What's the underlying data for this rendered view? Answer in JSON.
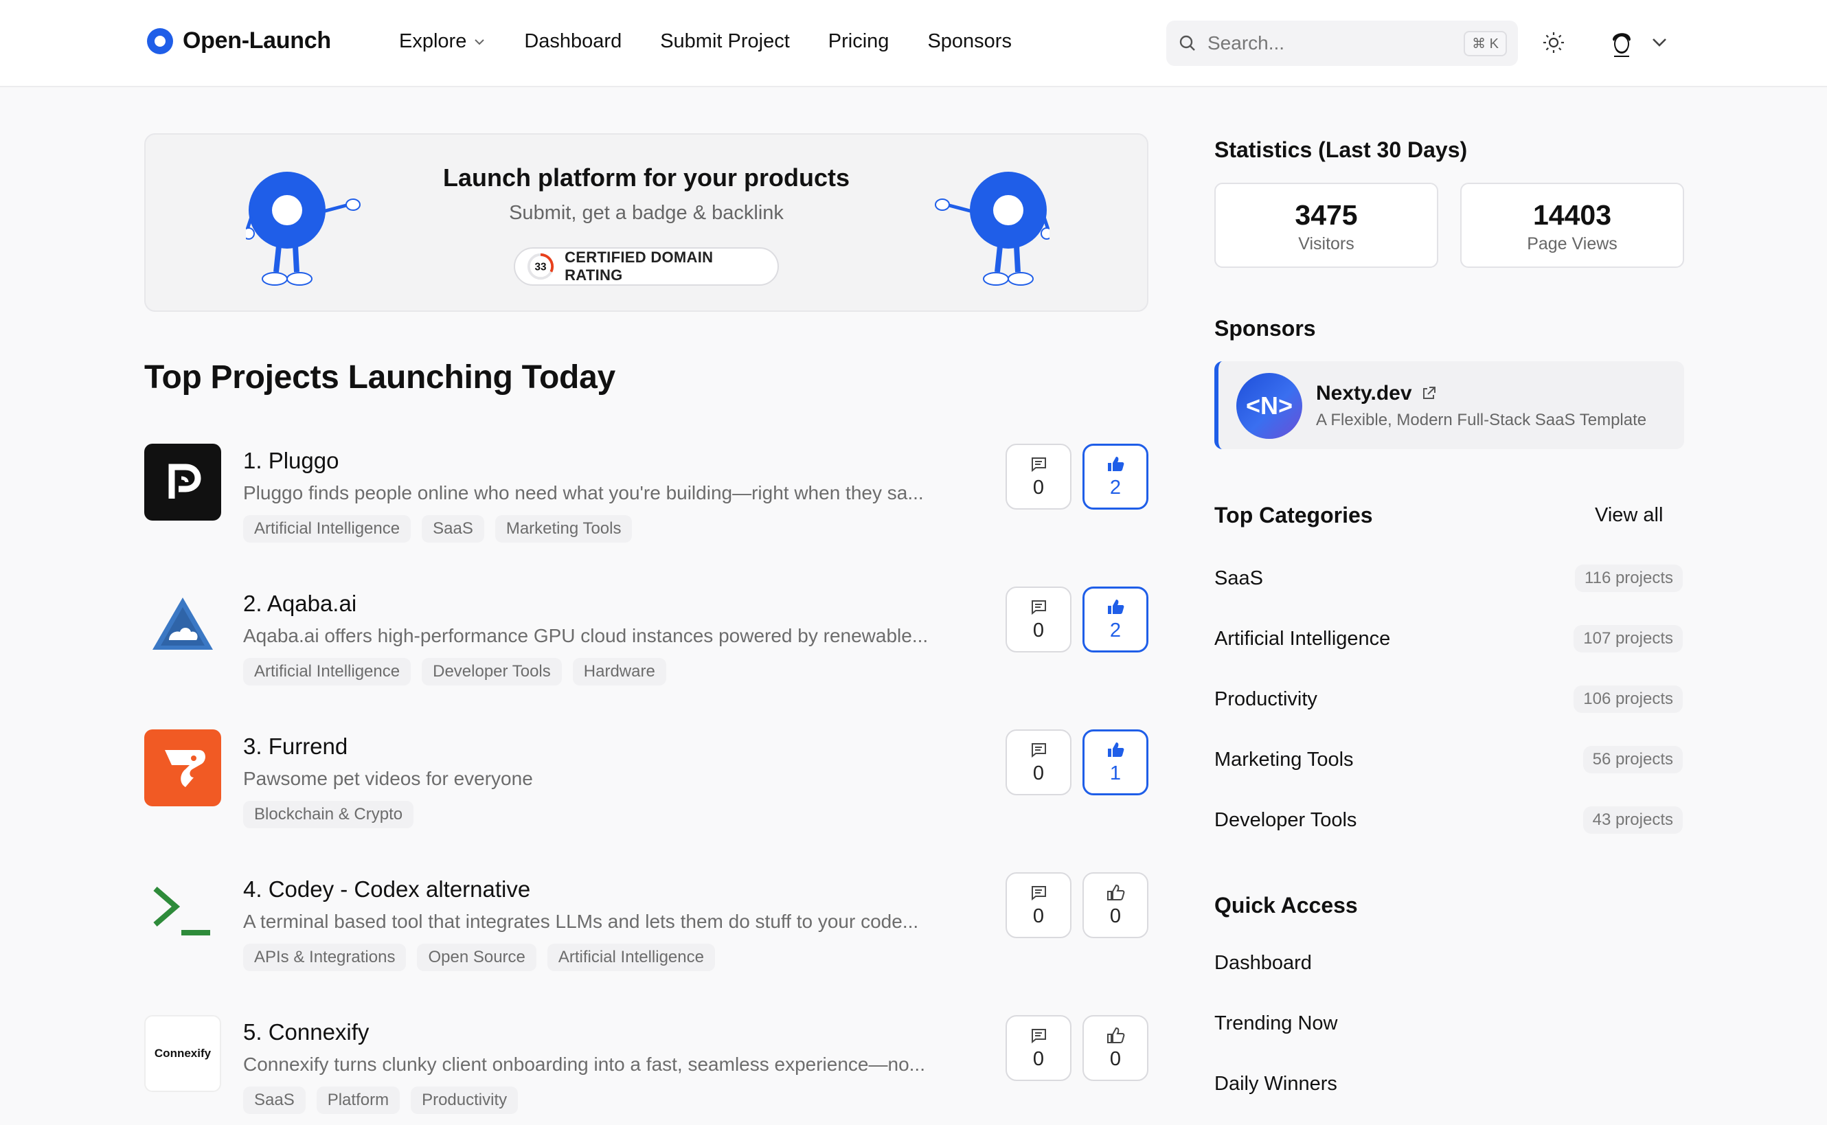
{
  "header": {
    "brand": "Open-Launch",
    "nav": [
      {
        "label": "Explore",
        "has_dropdown": true
      },
      {
        "label": "Dashboard"
      },
      {
        "label": "Submit Project"
      },
      {
        "label": "Pricing"
      },
      {
        "label": "Sponsors"
      }
    ],
    "search_placeholder": "Search...",
    "search_shortcut": "⌘ K"
  },
  "banner": {
    "title": "Launch platform for your products",
    "subtitle": "Submit, get a badge & backlink",
    "badge_score": "33",
    "badge_label": "CERTIFIED DOMAIN RATING"
  },
  "main": {
    "section_title": "Top Projects Launching Today",
    "projects": [
      {
        "title": "1. Pluggo",
        "description": "Pluggo finds people online who need what you're building—right when they sa...",
        "tags": [
          "Artificial Intelligence",
          "SaaS",
          "Marketing Tools"
        ],
        "comments": "0",
        "upvotes": "2",
        "upvoted": true,
        "logo": "pluggo-logo"
      },
      {
        "title": "2. Aqaba.ai",
        "description": "Aqaba.ai offers high-performance GPU cloud instances powered by renewable...",
        "tags": [
          "Artificial Intelligence",
          "Developer Tools",
          "Hardware"
        ],
        "comments": "0",
        "upvotes": "2",
        "upvoted": true,
        "logo": "aqaba-logo"
      },
      {
        "title": "3. Furrend",
        "description": "Pawsome pet videos for everyone",
        "tags": [
          "Blockchain & Crypto"
        ],
        "comments": "0",
        "upvotes": "1",
        "upvoted": true,
        "logo": "furrend-logo"
      },
      {
        "title": "4. Codey - Codex alternative",
        "description": "A terminal based tool that integrates LLMs and lets them do stuff to your code...",
        "tags": [
          "APIs & Integrations",
          "Open Source",
          "Artificial Intelligence"
        ],
        "comments": "0",
        "upvotes": "0",
        "upvoted": false,
        "logo": "terminal-logo"
      },
      {
        "title": "5. Connexify",
        "description": "Connexify turns clunky client onboarding into a fast, seamless experience—no...",
        "tags": [
          "SaaS",
          "Platform",
          "Productivity"
        ],
        "comments": "0",
        "upvotes": "0",
        "upvoted": false,
        "logo": "connexify-logo",
        "logo_text": "Connexify"
      }
    ]
  },
  "sidebar": {
    "stats_title": "Statistics (Last 30 Days)",
    "stats": [
      {
        "value": "3475",
        "label": "Visitors"
      },
      {
        "value": "14403",
        "label": "Page Views"
      }
    ],
    "sponsors_title": "Sponsors",
    "sponsor": {
      "logo_text": "<N>",
      "name": "Nexty.dev",
      "description": "A Flexible, Modern Full-Stack SaaS Template"
    },
    "categories_title": "Top Categories",
    "view_all": "View all",
    "categories": [
      {
        "name": "SaaS",
        "count": "116 projects"
      },
      {
        "name": "Artificial Intelligence",
        "count": "107 projects"
      },
      {
        "name": "Productivity",
        "count": "106 projects"
      },
      {
        "name": "Marketing Tools",
        "count": "56 projects"
      },
      {
        "name": "Developer Tools",
        "count": "43 projects"
      }
    ],
    "quick_access_title": "Quick Access",
    "quick_access": [
      "Dashboard",
      "Trending Now",
      "Daily Winners"
    ]
  },
  "colors": {
    "accent": "#1f5ee8",
    "background": "#f9f9fa",
    "furrend": "#f15a24",
    "codey": "#2e8b3a"
  }
}
